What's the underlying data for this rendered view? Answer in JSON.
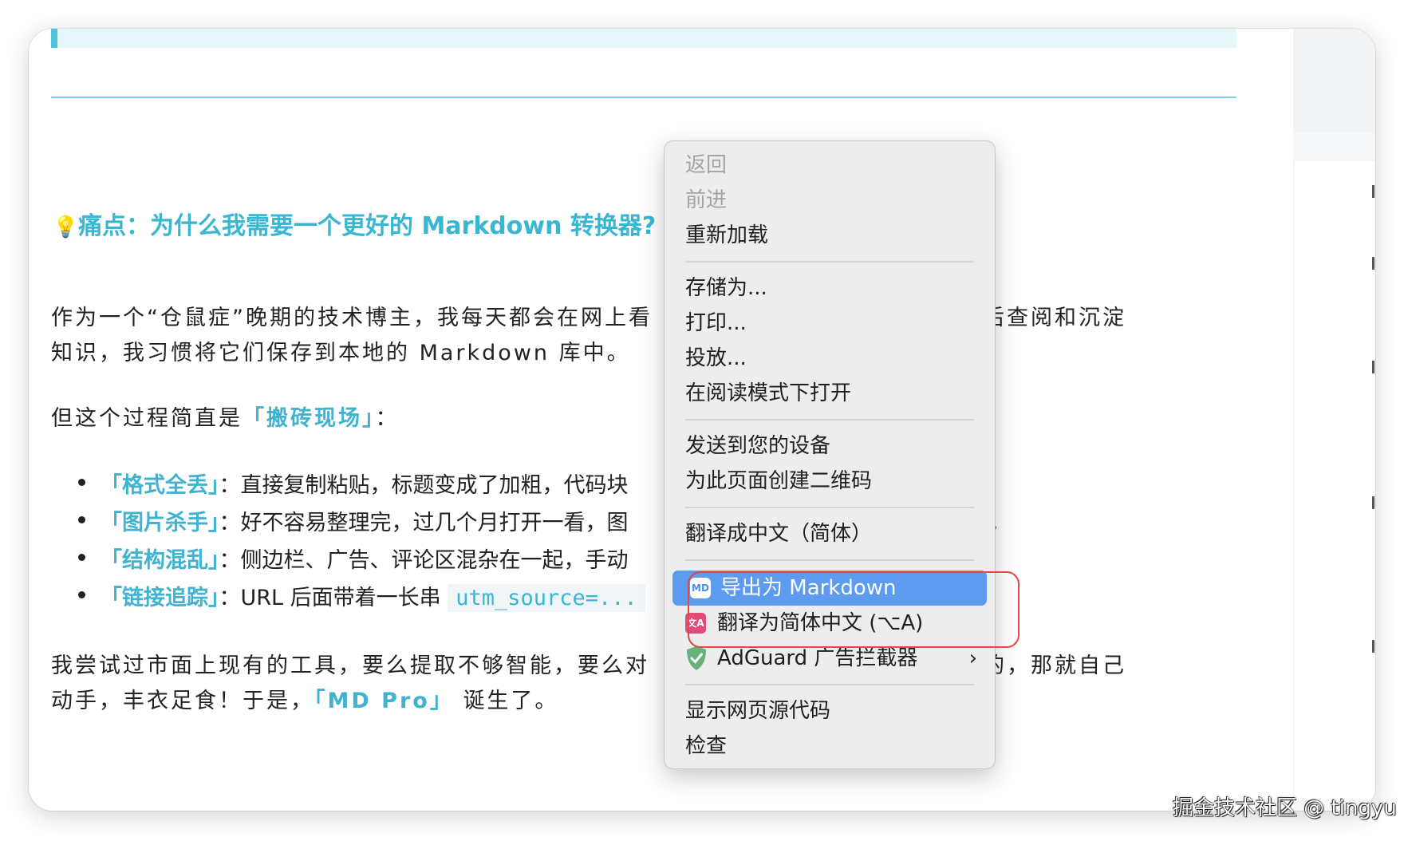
{
  "article": {
    "heading": "痛点：为什么我需要一个更好的 Markdown 转换器?",
    "bulb_icon": "lightbulb-icon",
    "p1_line1_left": "作为一个“仓鼠症”晚期的技术博主，我每天都会在网上看",
    "p1_line1_right": "方便日后查阅和沉淀",
    "p1_line2": "知识，我习惯将它们保存到本地的 Markdown 库中。",
    "p2_prefix": "但这个过程简直是",
    "p2_highlight": "「搬砖现场」",
    "p2_suffix": "：",
    "bullets": [
      {
        "label": "「格式全丢」",
        "text": "：直接复制粘贴，标题变成了加粗，代码块"
      },
      {
        "label": "「图片杀手」",
        "text": "：好不容易整理完，过几个月打开一看，图",
        "tail": "）。"
      },
      {
        "label": "「结构混乱」",
        "text": "：侧边栏、广告、评论区混杂在一起，手动"
      },
      {
        "label": "「链接追踪」",
        "text": "：URL 后面带着一长串 ",
        "code": "utm_source=..."
      }
    ],
    "p3_line1_left": "我尝试过市面上现有的工具，要么提取不够智能，要么对",
    "p3_line1_right": "有完美的，那就自己",
    "p3_line2_prefix": "动手，丰衣足食！于是，",
    "p3_highlight": "「MD Pro」",
    "p3_line2_suffix": "诞生了。"
  },
  "context_menu": {
    "back": "返回",
    "forward": "前进",
    "reload": "重新加载",
    "save_as": "存储为...",
    "print": "打印...",
    "cast": "投放...",
    "reader_mode": "在阅读模式下打开",
    "send_to_devices": "发送到您的设备",
    "create_qr": "为此页面创建二维码",
    "translate": "翻译成中文（简体）",
    "export_markdown": "导出为 Markdown",
    "translate_simplified": "翻译为简体中文 (⌥A)",
    "adguard": "AdGuard 广告拦截器",
    "view_source": "显示网页源代码",
    "inspect": "检查",
    "md_icon_text": "MD",
    "translate_icon_text": "文A"
  },
  "colors": {
    "accent": "#39b6d1",
    "menu_highlight": "#5c9bf0",
    "annotation_red": "#e24745",
    "adguard_green": "#67b279"
  },
  "watermark": "掘金技术社区 @ tingyu"
}
